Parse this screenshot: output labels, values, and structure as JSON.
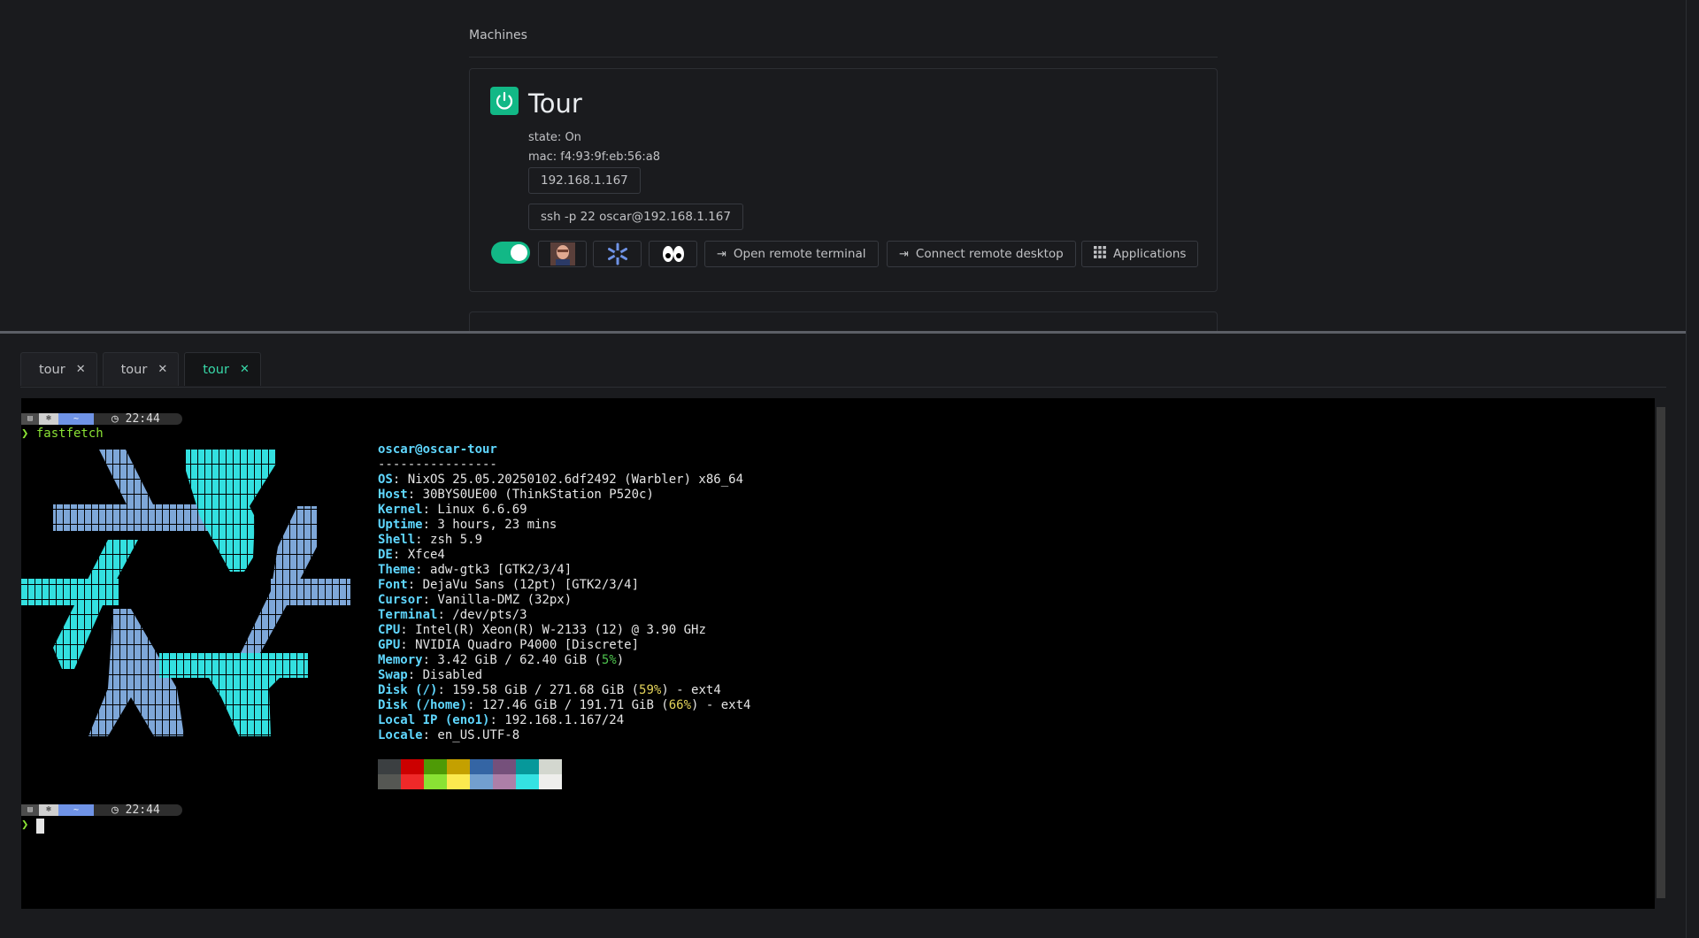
{
  "machines": {
    "section_title": "Machines",
    "machine": {
      "name": "Tour",
      "state": "state: On",
      "mac": "mac: f4:93:9f:eb:56:a8",
      "ip_button": "192.168.1.167",
      "ssh_button": "ssh -p 22 oscar@192.168.1.167",
      "toggle_on": true,
      "open_terminal_label": "Open remote terminal",
      "connect_desktop_label": "Connect remote desktop",
      "applications_label": "Applications"
    }
  },
  "tabs": [
    {
      "label": "tour",
      "active": false
    },
    {
      "label": "tour",
      "active": false
    },
    {
      "label": "tour",
      "active": true
    }
  ],
  "terminal": {
    "prompt_time": "22:44",
    "prompt_dir": "~",
    "command": "fastfetch",
    "userhost": "oscar@oscar-tour",
    "separator": "----------------",
    "info": [
      {
        "label": "OS",
        "value": ": NixOS 25.05.20250102.6df2492 (Warbler) x86_64"
      },
      {
        "label": "Host",
        "value": ": 30BYS0UE00 (ThinkStation P520c)"
      },
      {
        "label": "Kernel",
        "value": ": Linux 6.6.69"
      },
      {
        "label": "Uptime",
        "value": ": 3 hours, 23 mins"
      },
      {
        "label": "Shell",
        "value": ": zsh 5.9"
      },
      {
        "label": "DE",
        "value": ": Xfce4"
      },
      {
        "label": "Theme",
        "value": ": adw-gtk3 [GTK2/3/4]"
      },
      {
        "label": "Font",
        "value": ": DejaVu Sans (12pt) [GTK2/3/4]"
      },
      {
        "label": "Cursor",
        "value": ": Vanilla-DMZ (32px)"
      },
      {
        "label": "Terminal",
        "value": ": /dev/pts/3"
      },
      {
        "label": "CPU",
        "value": ": Intel(R) Xeon(R) W-2133 (12) @ 3.90 GHz"
      },
      {
        "label": "GPU",
        "value": ": NVIDIA Quadro P4000 [Discrete]"
      },
      {
        "label": "Memory",
        "value": ": 3.42 GiB / 62.40 GiB (",
        "pct": "5%",
        "pct_color": "#4ec44e",
        "tail": ")"
      },
      {
        "label": "Swap",
        "value": ": Disabled"
      },
      {
        "label": "Disk (/)",
        "value": ": 159.58 GiB / 271.68 GiB (",
        "pct": "59%",
        "pct_color": "#e5d45a",
        "tail": ") - ext4"
      },
      {
        "label": "Disk (/home)",
        "value": ": 127.46 GiB / 191.71 GiB (",
        "pct": "66%",
        "pct_color": "#e5d45a",
        "tail": ") - ext4"
      },
      {
        "label": "Local IP (eno1)",
        "value": ": 192.168.1.167/24"
      },
      {
        "label": "Locale",
        "value": ": en_US.UTF-8"
      }
    ],
    "palette_top": [
      "#3b3f41",
      "#cc0000",
      "#4e9a06",
      "#c4a000",
      "#3465a4",
      "#75507b",
      "#06989a",
      "#d3d7cf"
    ],
    "palette_bottom": [
      "#555753",
      "#ef2929",
      "#8ae234",
      "#fce94f",
      "#729fcf",
      "#ad7fa8",
      "#34e2e2",
      "#eeeeec"
    ],
    "logo_colors": {
      "blue": "#7ea7d8",
      "cyan": "#33e0e0"
    }
  }
}
